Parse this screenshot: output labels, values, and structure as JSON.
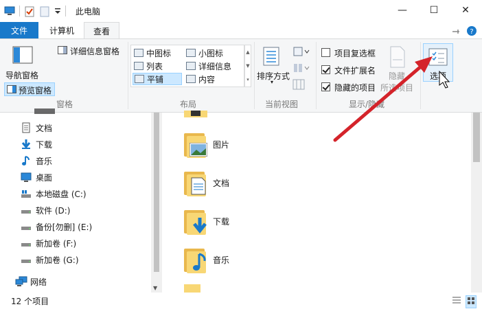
{
  "window": {
    "title": "此电脑",
    "controls": {
      "minimize": "—",
      "maximize": "☐",
      "close": "✕"
    }
  },
  "tabs": [
    {
      "label": "文件",
      "active": false
    },
    {
      "label": "计算机",
      "active": false
    },
    {
      "label": "查看",
      "active": true
    }
  ],
  "ribbon": {
    "panes": {
      "nav_pane": "导航窗格",
      "preview_pane": "预览窗格",
      "details_pane": "详细信息窗格",
      "group_label": "窗格"
    },
    "layout": {
      "items": [
        "中图标",
        "小图标",
        "列表",
        "详细信息",
        "平铺",
        "内容"
      ],
      "selected": "平铺",
      "group_label": "布局"
    },
    "current_view": {
      "sort_by": "排序方式",
      "group_label": "当前视图"
    },
    "show_hide": {
      "checkboxes": [
        {
          "label": "项目复选框",
          "checked": false
        },
        {
          "label": "文件扩展名",
          "checked": true
        },
        {
          "label": "隐藏的项目",
          "checked": true
        }
      ],
      "hide_selected_line1": "隐藏",
      "hide_selected_line2": "所选项目",
      "group_label": "显示/隐藏"
    },
    "options": {
      "label": "选项"
    }
  },
  "nav": {
    "items": [
      {
        "label": "文档",
        "icon": "document-icon"
      },
      {
        "label": "下载",
        "icon": "download-icon"
      },
      {
        "label": "音乐",
        "icon": "music-icon"
      },
      {
        "label": "桌面",
        "icon": "desktop-icon"
      },
      {
        "label": "本地磁盘 (C:)",
        "icon": "windows-drive-icon"
      },
      {
        "label": "软件 (D:)",
        "icon": "drive-icon"
      },
      {
        "label": "备份[勿删] (E:)",
        "icon": "drive-icon"
      },
      {
        "label": "新加卷 (F:)",
        "icon": "drive-icon"
      },
      {
        "label": "新加卷 (G:)",
        "icon": "drive-icon"
      },
      {
        "label": "网络",
        "icon": "network-icon"
      }
    ]
  },
  "content": {
    "items": [
      {
        "label": "图片",
        "overlay": "pictures"
      },
      {
        "label": "文档",
        "overlay": "documents"
      },
      {
        "label": "下载",
        "overlay": "downloads"
      },
      {
        "label": "音乐",
        "overlay": "music"
      }
    ]
  },
  "status": {
    "item_count": "12 个项目"
  },
  "colors": {
    "accent": "#1979ca",
    "folder": "#f8d775",
    "selection": "#cce8ff",
    "arrow": "#d4232a"
  }
}
